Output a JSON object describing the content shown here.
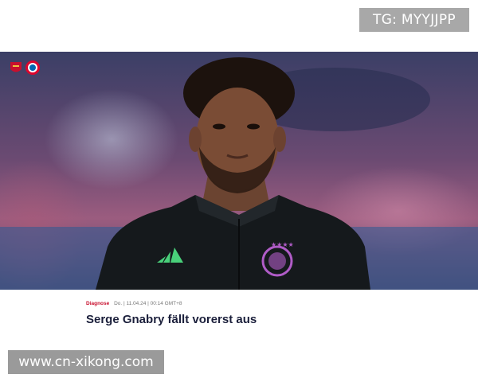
{
  "watermark_top": "TG: MYYJJPP",
  "watermark_bottom": "www.cn-xikong.com",
  "hero": {
    "club_logos": [
      "arsenal-crest-icon",
      "fc-bayern-crest-icon"
    ],
    "kit_logos": [
      "adidas-icon",
      "fc-bayern-badge-icon"
    ]
  },
  "article": {
    "category": "Diagnose",
    "meta": "Do. | 11.04.24 | 00:14 GMT+8",
    "headline": "Serge Gnabry fällt vorerst aus"
  },
  "colors": {
    "category": "#c8102e",
    "headline": "#1b1f3b",
    "jersey": "#15191c",
    "adidas_stripes": "#49d07a",
    "badge": "#b05cc7"
  }
}
